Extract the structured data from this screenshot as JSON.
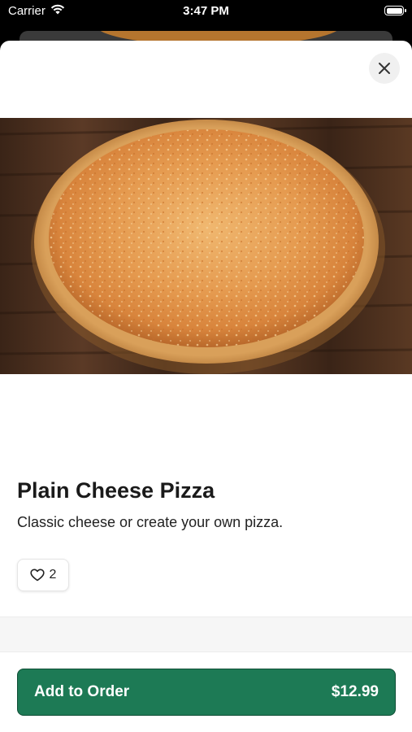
{
  "status_bar": {
    "carrier": "Carrier",
    "time": "3:47 PM",
    "wifi_icon": "wifi-icon",
    "battery_icon": "battery-icon"
  },
  "sheet": {
    "close_icon": "close-icon"
  },
  "product": {
    "name": "Plain Cheese Pizza",
    "description": "Classic cheese or create your own pizza.",
    "likes": "2",
    "like_icon": "heart-outline-icon"
  },
  "footer": {
    "add_label": "Add to Order",
    "price": "$12.99"
  },
  "colors": {
    "accent": "#1d7a55",
    "accent_border": "#0f4e36"
  }
}
